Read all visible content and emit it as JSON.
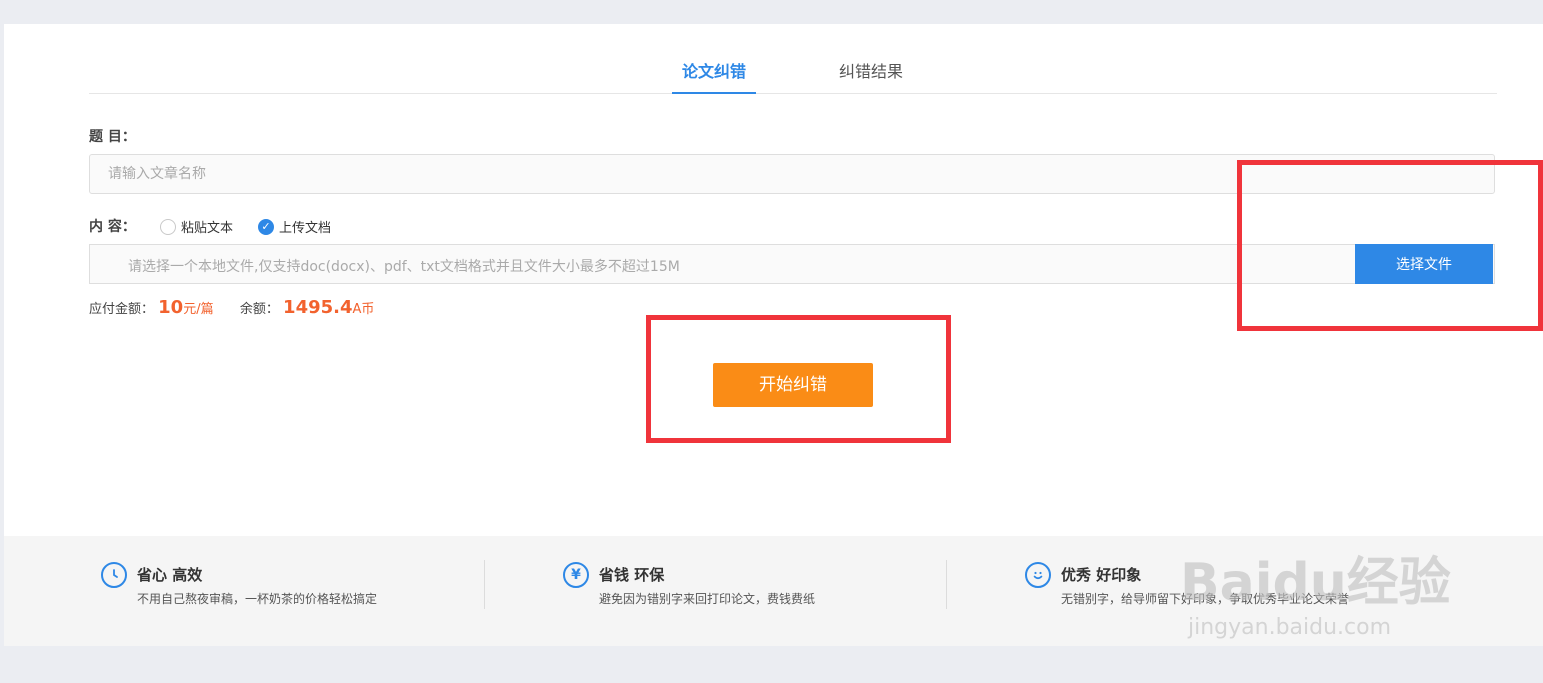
{
  "tabs": [
    {
      "label": "论文纠错",
      "active": true
    },
    {
      "label": "纠错结果",
      "active": false
    }
  ],
  "form": {
    "title_label": "题 目：",
    "title_placeholder": "请输入文章名称",
    "content_label": "内 容：",
    "radio_paste": "粘贴文本",
    "radio_upload": "上传文档",
    "radio_selected": "上传文档",
    "file_hint": "请选择一个本地文件,仅支持doc(docx)、pdf、txt文档格式并且文件大小最多不超过15M",
    "file_button": "选择文件"
  },
  "payment": {
    "due_label": "应付金额：",
    "due_amount": "10",
    "due_unit": "元/篇",
    "balance_label": "余额：",
    "balance_amount": "1495.4",
    "balance_unit": "A币"
  },
  "start_button": "开始纠错",
  "features": [
    {
      "icon": "clock-icon",
      "title": "省心 高效",
      "desc": "不用自己熬夜审稿，一杯奶茶的价格轻松搞定"
    },
    {
      "icon": "yen-icon",
      "title": "省钱 环保",
      "desc": "避免因为错别字来回打印论文，费钱费纸"
    },
    {
      "icon": "smile-icon",
      "title": "优秀 好印象",
      "desc": "无错别字，给导师留下好印象，争取优秀毕业论文荣誉"
    }
  ],
  "watermark": {
    "brand": "Baidu经验",
    "url": "jingyan.baidu.com"
  },
  "colors": {
    "accent": "#2e88e6",
    "start_button": "#fa8c16",
    "price": "#f2622e",
    "highlight_box": "#f0343b"
  }
}
